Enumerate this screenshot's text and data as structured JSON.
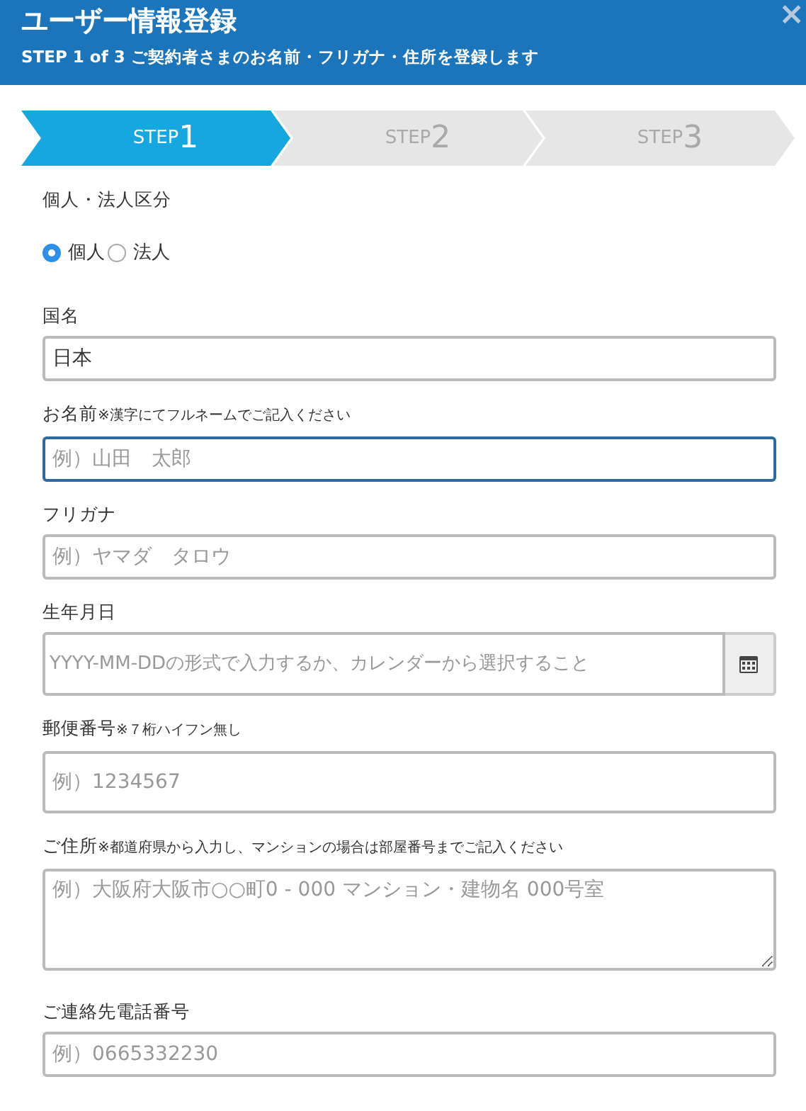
{
  "header": {
    "title": "ユーザー情報登録",
    "subtitle": "STEP 1 of 3 ご契約者さまのお名前・フリガナ・住所を登録します",
    "close": "×"
  },
  "steps": [
    {
      "label": "STEP",
      "number": "1",
      "selected": true
    },
    {
      "label": "STEP",
      "number": "2",
      "selected": false
    },
    {
      "label": "STEP",
      "number": "3",
      "selected": false
    }
  ],
  "fields": [
    {
      "kind": "radio",
      "label": "個人・法人区分",
      "options": [
        {
          "label": "個人",
          "selected": true
        },
        {
          "label": "法人",
          "selected": false
        }
      ]
    },
    {
      "kind": "text",
      "label": "国名",
      "value": "日本",
      "focused": false
    },
    {
      "kind": "text",
      "label": "お名前",
      "note": "※漢字にてフルネームでご記入ください",
      "placeholder": "例）山田　太郎",
      "focused": true
    },
    {
      "kind": "text",
      "label": "フリガナ",
      "placeholder": "例）ヤマダ　タロウ",
      "focused": false
    },
    {
      "kind": "date",
      "label": "生年月日",
      "placeholder": "YYYY-MM-DDの形式で入力するか、カレンダーから選択すること",
      "focused": false
    },
    {
      "kind": "tall",
      "label": "郵便番号",
      "note": "※７桁ハイフン無し",
      "placeholder": "例）1234567",
      "focused": false
    },
    {
      "kind": "textarea",
      "label": "ご住所",
      "note": "※都道府県から入力し、マンションの場合は部屋番号までご記入ください",
      "placeholder": "例）大阪府大阪市○○町0 - 000 マンション・建物名 000号室",
      "focused": false
    },
    {
      "kind": "text",
      "label": "ご連絡先電話番号",
      "placeholder": "例）0665332230",
      "focused": false
    }
  ]
}
